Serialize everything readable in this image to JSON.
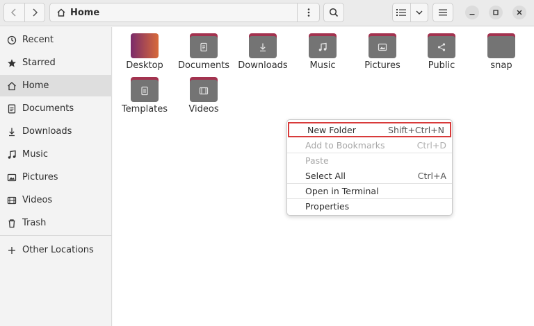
{
  "header": {
    "location": "Home"
  },
  "sidebar": {
    "items": [
      {
        "label": "Recent",
        "icon": "clock-icon"
      },
      {
        "label": "Starred",
        "icon": "star-icon"
      },
      {
        "label": "Home",
        "icon": "home-icon",
        "active": true
      },
      {
        "label": "Documents",
        "icon": "document-icon"
      },
      {
        "label": "Downloads",
        "icon": "download-icon"
      },
      {
        "label": "Music",
        "icon": "music-icon"
      },
      {
        "label": "Pictures",
        "icon": "picture-icon"
      },
      {
        "label": "Videos",
        "icon": "video-icon"
      },
      {
        "label": "Trash",
        "icon": "trash-icon"
      }
    ],
    "other_locations": "Other Locations"
  },
  "files": [
    {
      "label": "Desktop",
      "icon": "desktop-folder-icon"
    },
    {
      "label": "Documents",
      "icon": "documents-folder-icon"
    },
    {
      "label": "Downloads",
      "icon": "downloads-folder-icon"
    },
    {
      "label": "Music",
      "icon": "music-folder-icon"
    },
    {
      "label": "Pictures",
      "icon": "pictures-folder-icon"
    },
    {
      "label": "Public",
      "icon": "public-folder-icon"
    },
    {
      "label": "snap",
      "icon": "folder-icon"
    },
    {
      "label": "Templates",
      "icon": "templates-folder-icon"
    },
    {
      "label": "Videos",
      "icon": "videos-folder-icon"
    }
  ],
  "context_menu": {
    "items": [
      {
        "label": "New Folder",
        "shortcut": "Shift+Ctrl+N",
        "highlighted": true
      },
      {
        "label": "Add to Bookmarks",
        "shortcut": "Ctrl+D",
        "disabled": true
      },
      {
        "label": "Paste",
        "shortcut": "",
        "disabled": true
      },
      {
        "label": "Select All",
        "shortcut": "Ctrl+A"
      },
      {
        "label": "Open in Terminal",
        "shortcut": ""
      },
      {
        "label": "Properties",
        "shortcut": ""
      }
    ]
  },
  "colors": {
    "folder_tab": "#a3324f",
    "folder_body": "#747474",
    "highlight_border": "#d83a3a"
  }
}
